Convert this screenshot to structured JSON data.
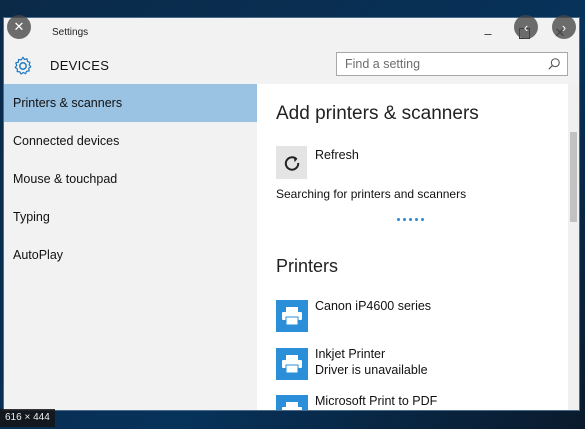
{
  "window": {
    "title": "Settings"
  },
  "header": {
    "section": "DEVICES",
    "search_placeholder": "Find a setting"
  },
  "sidebar": {
    "items": [
      {
        "label": "Printers & scanners"
      },
      {
        "label": "Connected devices"
      },
      {
        "label": "Mouse & touchpad"
      },
      {
        "label": "Typing"
      },
      {
        "label": "AutoPlay"
      }
    ]
  },
  "main": {
    "add_heading": "Add printers & scanners",
    "refresh_label": "Refresh",
    "status": "Searching for printers and scanners",
    "printers_heading": "Printers",
    "printers": [
      {
        "name": "Canon iP4600 series",
        "sub": ""
      },
      {
        "name": "Inkjet Printer",
        "sub": "Driver is unavailable"
      },
      {
        "name": "Microsoft Print to PDF",
        "sub": ""
      }
    ]
  },
  "image_badge": "616 × 444",
  "colors": {
    "accent": "#2a8fd8",
    "selected": "#9ac2e2"
  }
}
